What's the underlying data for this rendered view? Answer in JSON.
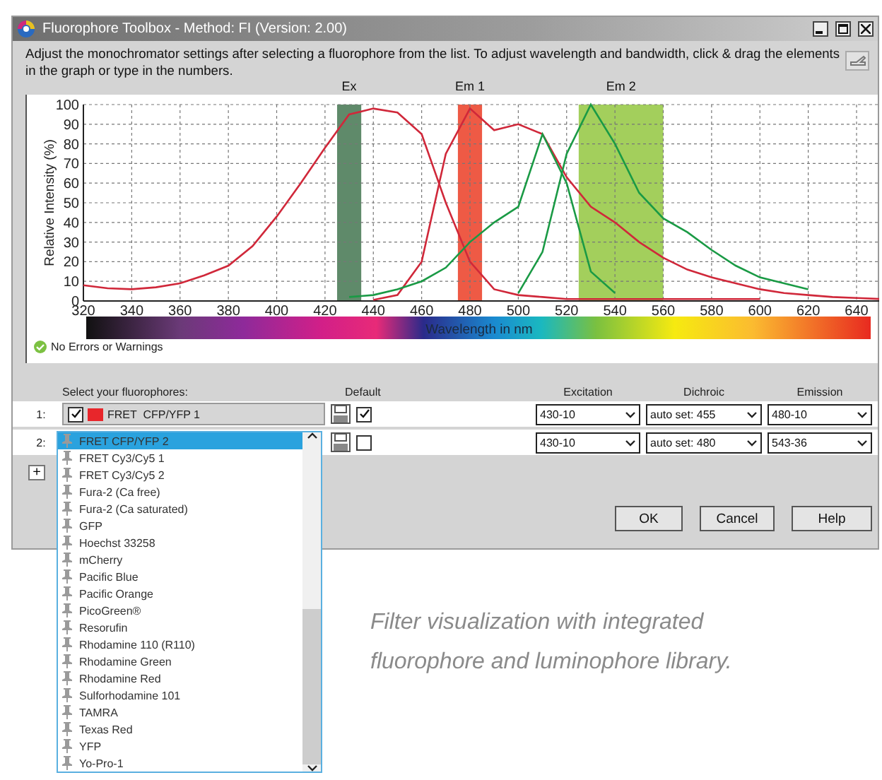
{
  "window": {
    "title": "Fluorophore Toolbox - Method: FI (Version: 2.00)"
  },
  "instructions": "Adjust the monochromator settings after selecting a fluorophore from the list. To adjust wavelength and bandwidth, click & drag the elements in the graph or type in the numbers.",
  "chart": {
    "chart_data": {
      "type": "line",
      "ylabel": "Relative Intensity (%)",
      "xlabel": "Wavelength in nm",
      "x": [
        320,
        330,
        340,
        350,
        360,
        370,
        380,
        390,
        400,
        410,
        420,
        430,
        440,
        450,
        460,
        470,
        480,
        490,
        500,
        510,
        520,
        530,
        540,
        550,
        560,
        570,
        580,
        590,
        600,
        610,
        620,
        630,
        640,
        650
      ],
      "series": [
        {
          "color": "#d0283a",
          "values": [
            8,
            6.5,
            6,
            7,
            9,
            13,
            18,
            28,
            43,
            60,
            78,
            95,
            98,
            96,
            85,
            50,
            20,
            6,
            3,
            2,
            1,
            1,
            1,
            1,
            1,
            1,
            1,
            1,
            1,
            null,
            null,
            null,
            null,
            null
          ]
        },
        {
          "color": "#d0283a",
          "values": [
            null,
            null,
            null,
            null,
            null,
            null,
            null,
            null,
            null,
            null,
            null,
            null,
            0.5,
            3,
            20,
            75,
            98,
            87,
            90,
            85,
            63,
            48,
            40,
            30,
            22,
            16,
            12,
            9,
            6,
            4,
            3,
            2,
            1.5,
            1
          ]
        },
        {
          "color": "#1a9a45",
          "values": [
            null,
            null,
            null,
            null,
            null,
            null,
            null,
            null,
            null,
            null,
            null,
            2,
            3,
            6,
            10,
            17,
            30,
            40,
            48,
            85,
            60,
            15,
            4,
            null,
            null,
            null,
            null,
            null,
            null,
            null,
            null,
            null,
            null,
            null
          ]
        },
        {
          "color": "#1a9a45",
          "values": [
            null,
            null,
            null,
            null,
            null,
            null,
            null,
            null,
            null,
            null,
            null,
            null,
            null,
            null,
            null,
            null,
            null,
            null,
            4,
            25,
            75,
            100,
            80,
            55,
            42,
            35,
            26,
            18,
            12,
            9,
            6,
            null,
            null,
            null
          ]
        }
      ],
      "xlim": [
        320,
        650
      ],
      "ylim": [
        0,
        100
      ],
      "xticks": [
        320,
        340,
        360,
        380,
        400,
        420,
        440,
        460,
        480,
        500,
        520,
        540,
        560,
        580,
        600,
        620,
        640
      ],
      "yticks": [
        0,
        10,
        20,
        30,
        40,
        50,
        60,
        70,
        80,
        90,
        100
      ],
      "grid": true,
      "bands": [
        {
          "label": "Ex",
          "axis": "x",
          "from": 425,
          "to": 435,
          "color": "#5f8a6a"
        },
        {
          "label": "Em 1",
          "axis": "x",
          "from": 475,
          "to": 485,
          "color": "#ee5a45"
        },
        {
          "label": "Em 2",
          "axis": "x",
          "from": 525,
          "to": 560,
          "color": "#a3cf5c"
        }
      ]
    }
  },
  "status": "No Errors or Warnings",
  "headers": {
    "fluorophore": "Select your fluorophores:",
    "default": "Default",
    "excitation": "Excitation",
    "dichroic": "Dichroic",
    "emission": "Emission"
  },
  "rows": [
    {
      "number": "1:",
      "enabled": true,
      "color": "#e8262b",
      "fluorophore": "FRET  CFP/YFP 1",
      "default": true,
      "excitation": "430-10",
      "dichroic": "auto set: 455",
      "emission": "480-10"
    },
    {
      "number": "2:",
      "default": false,
      "excitation": "430-10",
      "dichroic": "auto set: 480",
      "emission": "543-36",
      "fluorophore_list": [
        {
          "label": "FRET CFP/YFP 2",
          "selected": true
        },
        {
          "label": "FRET Cy3/Cy5 1",
          "selected": false
        },
        {
          "label": "FRET Cy3/Cy5 2",
          "selected": false
        },
        {
          "label": "Fura-2 (Ca free)",
          "selected": false
        },
        {
          "label": "Fura-2 (Ca saturated)",
          "selected": false
        },
        {
          "label": "GFP",
          "selected": false
        },
        {
          "label": "Hoechst 33258",
          "selected": false
        },
        {
          "label": "mCherry",
          "selected": false
        },
        {
          "label": "Pacific Blue",
          "selected": false
        },
        {
          "label": "Pacific Orange",
          "selected": false
        },
        {
          "label": "PicoGreen®",
          "selected": false
        },
        {
          "label": "Resorufin",
          "selected": false
        },
        {
          "label": "Rhodamine 110 (R110)",
          "selected": false
        },
        {
          "label": "Rhodamine Green",
          "selected": false
        },
        {
          "label": "Rhodamine Red",
          "selected": false
        },
        {
          "label": "Sulforhodamine 101",
          "selected": false
        },
        {
          "label": "TAMRA",
          "selected": false
        },
        {
          "label": "Texas Red",
          "selected": false
        },
        {
          "label": "YFP",
          "selected": false
        },
        {
          "label": "Yo-Pro-1",
          "selected": false
        }
      ]
    }
  ],
  "add_button": "+",
  "buttons": [
    "OK",
    "Cancel",
    "Help"
  ],
  "caption": "Filter visualization with integrated fluorophore and luminophore library."
}
